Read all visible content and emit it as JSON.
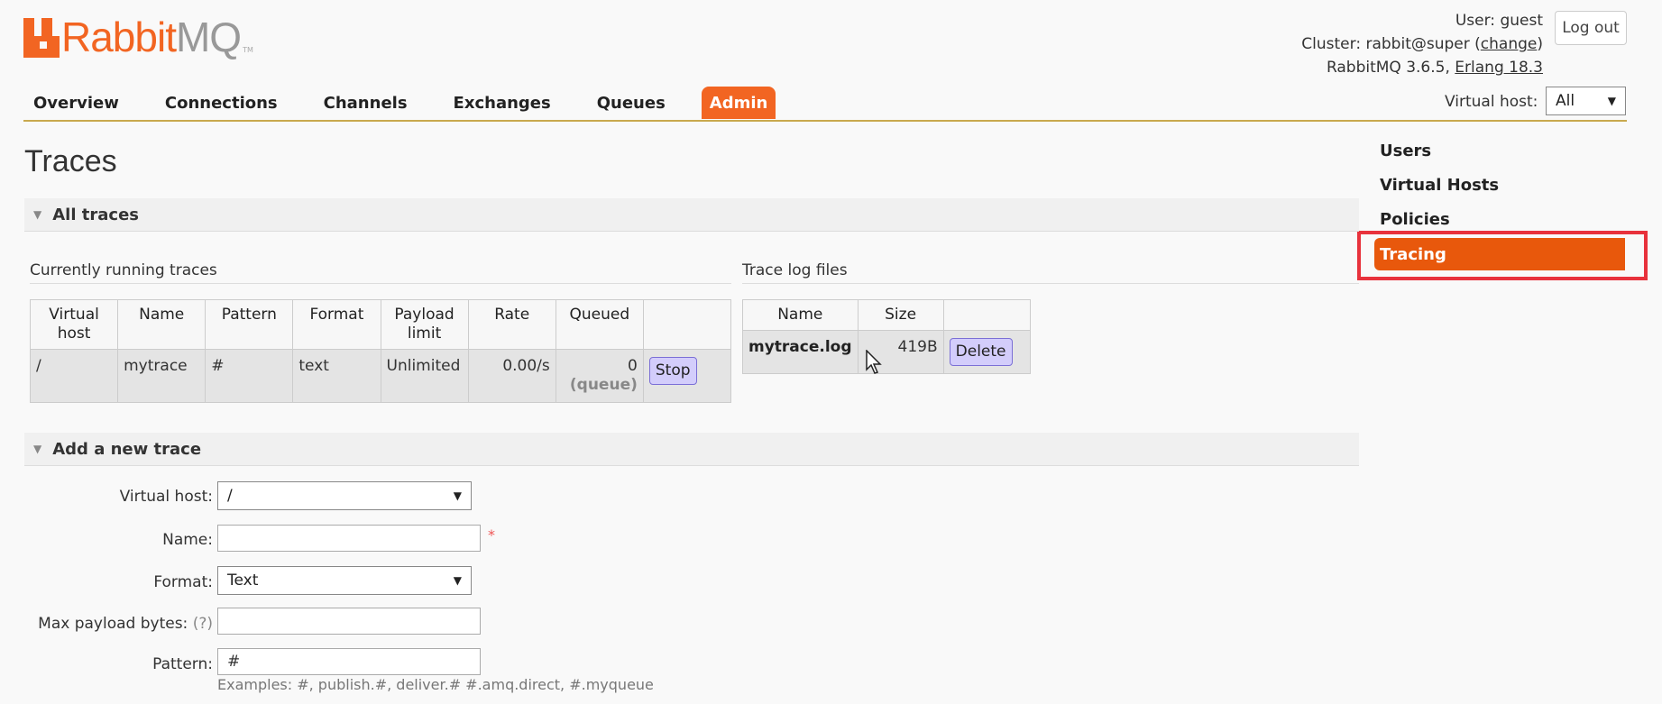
{
  "logo": {
    "brand_a": "Rabbit",
    "brand_b": "MQ",
    "tm": "TM"
  },
  "user_info": {
    "user_label": "User:",
    "user": "guest",
    "cluster_label": "Cluster:",
    "cluster": "rabbit@super",
    "change": "change",
    "version": "RabbitMQ 3.6.5,",
    "erlang": "Erlang 18.3"
  },
  "logout_label": "Log out",
  "nav": {
    "items": [
      "Overview",
      "Connections",
      "Channels",
      "Exchanges",
      "Queues",
      "Admin"
    ],
    "active": "Admin"
  },
  "vhost_selector": {
    "label": "Virtual host:",
    "value": "All"
  },
  "side_menu": {
    "items": [
      "Users",
      "Virtual Hosts",
      "Policies",
      "Tracing"
    ],
    "active": "Tracing"
  },
  "page_title": "Traces",
  "all_traces": {
    "title": "All traces",
    "running": {
      "label": "Currently running traces",
      "headers": [
        "Virtual host",
        "Name",
        "Pattern",
        "Format",
        "Payload limit",
        "Rate",
        "Queued"
      ],
      "row": {
        "vhost": "/",
        "name": "mytrace",
        "pattern": "#",
        "format": "text",
        "payload_limit": "Unlimited",
        "rate": "0.00/s",
        "queued": "0",
        "queued_unit": "(queue)",
        "action": "Stop"
      }
    },
    "logs": {
      "label": "Trace log files",
      "headers": [
        "Name",
        "Size"
      ],
      "row": {
        "name": "mytrace.log",
        "size": "419B",
        "action": "Delete"
      }
    }
  },
  "add_trace": {
    "title": "Add a new trace",
    "fields": {
      "vhost_label": "Virtual host:",
      "vhost_value": "/",
      "name_label": "Name:",
      "name_value": "",
      "required_mark": "*",
      "format_label": "Format:",
      "format_value": "Text",
      "max_payload_label": "Max payload bytes:",
      "max_payload_help": "(?)",
      "max_payload_value": "",
      "pattern_label": "Pattern:",
      "pattern_value": "#",
      "examples": "Examples: #, publish.#, deliver.# #.amq.direct, #.myqueue"
    }
  },
  "colors": {
    "accent": "#f26522",
    "highlight": "#e8323c",
    "button": "#d3cdfb"
  }
}
